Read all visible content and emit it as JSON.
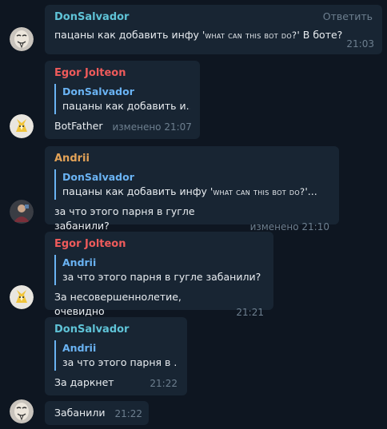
{
  "colors": {
    "background": "#0e1621",
    "bubble": "#182533",
    "time": "#6d7f8f",
    "reply_bar": "#6ab3f3"
  },
  "messages": [
    {
      "sender": "DonSalvador",
      "sender_color": "#5fc3d7",
      "text_before": "пацаны как добавить инфу '",
      "text_sc": "WHAT CAN THIS BOT DO?",
      "text_after": "' В боте?",
      "time": "21:03",
      "action": "Ответить",
      "avatar": "guy-fawkes-mask-icon"
    },
    {
      "sender": "Egor Jolteon",
      "sender_color": "#ef5b5b",
      "reply_name": "DonSalvador",
      "reply_text": "пацаны как добавить и...",
      "text": "BotFather",
      "time": "изменено 21:07",
      "avatar": "jolteon-icon"
    },
    {
      "sender": "Andrii",
      "sender_color": "#e3a358",
      "reply_name": "DonSalvador",
      "reply_before": "пацаны как добавить инфу '",
      "reply_sc": "WHAT CAN THIS BOT DO?",
      "reply_after": "'...",
      "text": "за что этого парня в гугле забанили?",
      "time": "изменено 21:10",
      "avatar": "person-photo-icon"
    },
    {
      "sender": "Egor Jolteon",
      "sender_color": "#ef5b5b",
      "reply_name": "Andrii",
      "reply_text": "за что этого парня в гугле забанили?",
      "text": "За несовершеннолетие, очевидно",
      "time": "21:21",
      "avatar": "jolteon-icon"
    },
    {
      "sender": "DonSalvador",
      "sender_color": "#5fc3d7",
      "reply_name": "Andrii",
      "reply_text": "за что этого парня в ...",
      "text": "За даркнет",
      "time": "21:22"
    },
    {
      "text": "Забанили",
      "time": "21:22",
      "avatar": "guy-fawkes-mask-icon"
    }
  ]
}
